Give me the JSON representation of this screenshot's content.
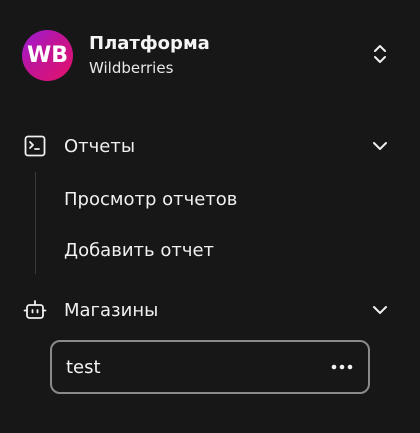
{
  "header": {
    "logo_text": "WB",
    "title": "Платформа",
    "subtitle": "Wildberries",
    "logo_gradient": [
      "#9a1cd8",
      "#c01497",
      "#e5126a"
    ]
  },
  "nav": {
    "reports": {
      "label": "Отчеты",
      "icon": "terminal-icon",
      "expanded": true,
      "items": [
        {
          "label": "Просмотр отчетов"
        },
        {
          "label": "Добавить отчет"
        }
      ]
    },
    "stores": {
      "label": "Магазины",
      "icon": "bot-icon",
      "expanded": true,
      "items": [
        {
          "label": "test",
          "action_icon": "more-horizontal-icon"
        }
      ]
    }
  },
  "colors": {
    "background": "#171717",
    "text": "#f0f0f0",
    "active_border": "#8a8a8a",
    "divider": "#3a3a3a"
  }
}
